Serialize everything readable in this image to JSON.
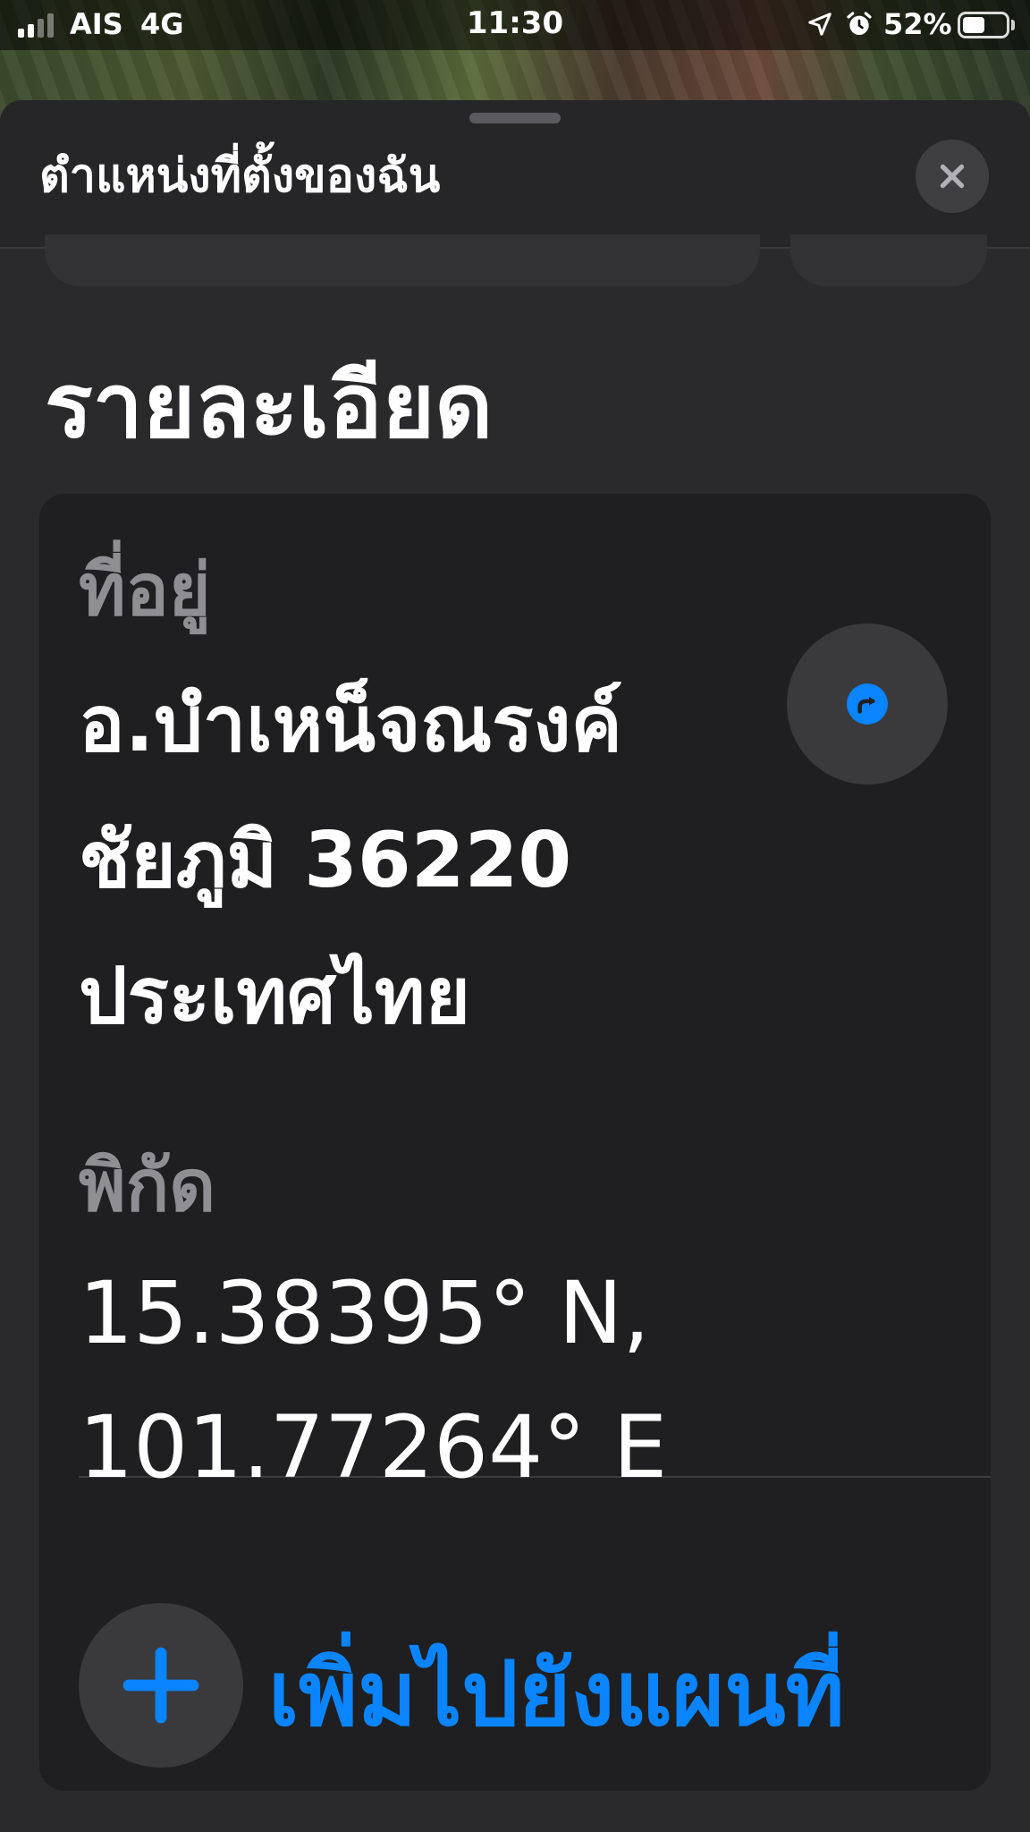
{
  "status_bar": {
    "carrier": "AIS",
    "network": "4G",
    "time": "11:30",
    "battery_percent": "52%",
    "battery_level": 0.52,
    "signal_bars": 2,
    "icons": [
      "location-arrow-icon",
      "alarm-clock-icon",
      "battery-icon"
    ]
  },
  "sheet": {
    "title": "ตำแหน่งที่ตั้งของฉัน",
    "close_icon": "close-icon"
  },
  "details": {
    "heading": "รายละเอียด",
    "address_label": "ที่อยู่",
    "address_lines": [
      "อ.บำเหน็จณรงค์",
      "ชัยภูมิ 36220",
      "ประเทศไทย"
    ],
    "coordinates_label": "พิกัด",
    "coordinates_lines": [
      "15.38395° N,",
      "101.77264° E"
    ],
    "share_icon": "share-arrow-icon"
  },
  "add_to_map": {
    "label": "เพิ่มไปยังแผนที่",
    "icon": "plus-icon"
  },
  "colors": {
    "accent": "#0a84ff",
    "sheet_bg": "#2a2a2c",
    "card_bg": "#1f1f21",
    "label_gray": "#8e8e93"
  }
}
